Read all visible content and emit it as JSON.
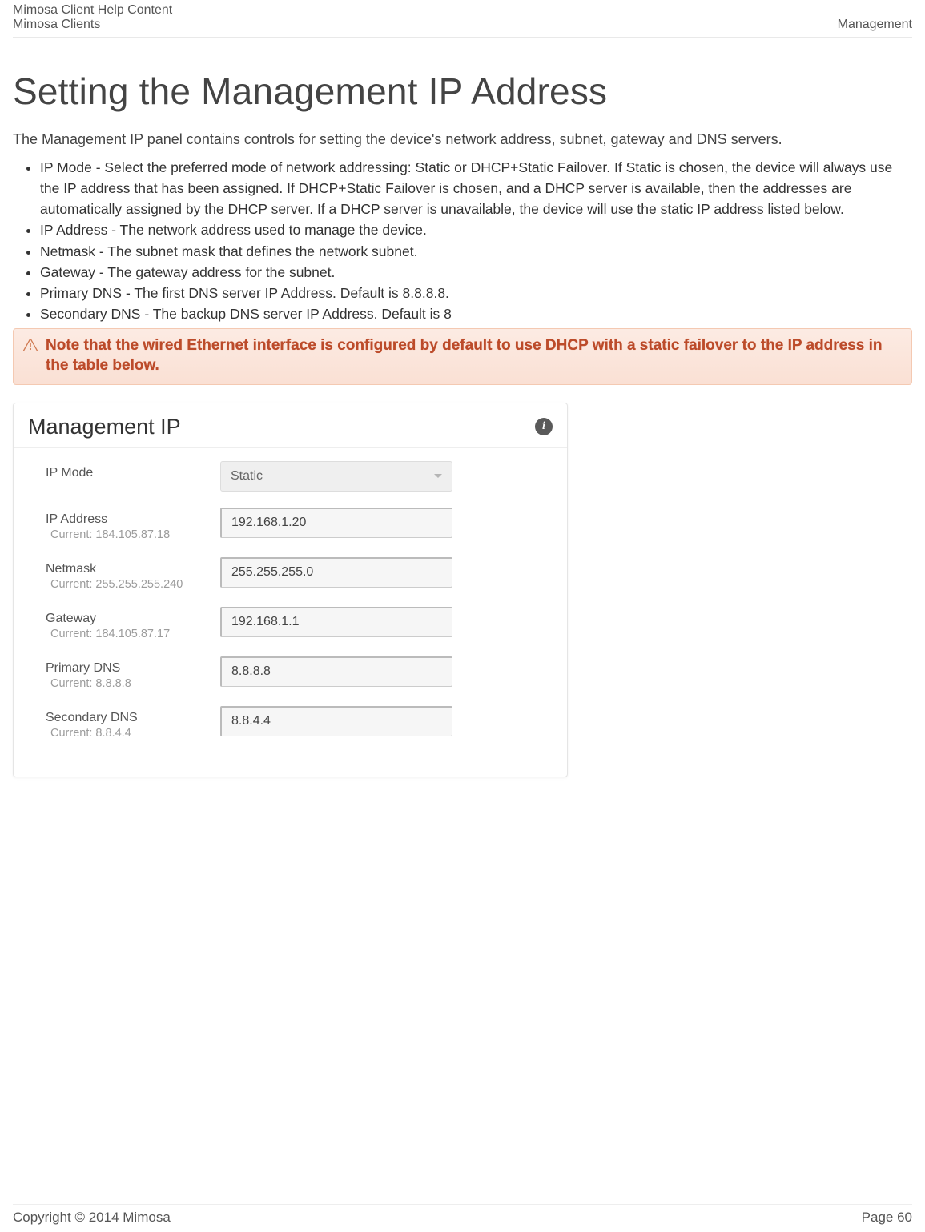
{
  "header": {
    "line1": "Mimosa Client Help Content",
    "left": "Mimosa Clients",
    "right": "Management"
  },
  "title": "Setting the Management IP Address",
  "intro": "The Management IP panel contains controls for setting the device's network address, subnet, gateway and DNS servers.",
  "bullets": [
    "IP Mode - Select the preferred mode of network addressing: Static or DHCP+Static Failover. If Static is chosen, the device will always use the IP address that has been assigned. If DHCP+Static Failover is chosen, and a DHCP server is available, then the addresses are automatically assigned by the DHCP server. If a DHCP server is unavailable, the device will use the static IP address listed below.",
    "IP Address - The network address used to manage the device.",
    "Netmask - The subnet mask that defines the network subnet.",
    "Gateway - The gateway address for the subnet.",
    "Primary DNS - The first DNS server IP Address. Default is 8.8.8.8.",
    "Secondary DNS - The backup DNS server IP Address. Default is 8"
  ],
  "warning": "Note that the wired Ethernet interface is configured by default to use DHCP with a static failover to the IP address in the table below.",
  "panel": {
    "title": "Management IP",
    "info_glyph": "i",
    "rows": {
      "ip_mode": {
        "label": "IP Mode",
        "value": "Static"
      },
      "ip_address": {
        "label": "IP Address",
        "current_prefix": "Current: ",
        "current": "184.105.87.18",
        "value": "192.168.1.20"
      },
      "netmask": {
        "label": "Netmask",
        "current_prefix": "Current: ",
        "current": "255.255.255.240",
        "value": "255.255.255.0"
      },
      "gateway": {
        "label": "Gateway",
        "current_prefix": "Current: ",
        "current": "184.105.87.17",
        "value": "192.168.1.1"
      },
      "primary_dns": {
        "label": "Primary DNS",
        "current_prefix": "Current: ",
        "current": "8.8.8.8",
        "value": "8.8.8.8"
      },
      "secondary_dns": {
        "label": "Secondary DNS",
        "current_prefix": "Current: ",
        "current": "8.8.4.4",
        "value": "8.8.4.4"
      }
    }
  },
  "footer": {
    "copyright": "Copyright © 2014 Mimosa",
    "page": "Page 60"
  }
}
